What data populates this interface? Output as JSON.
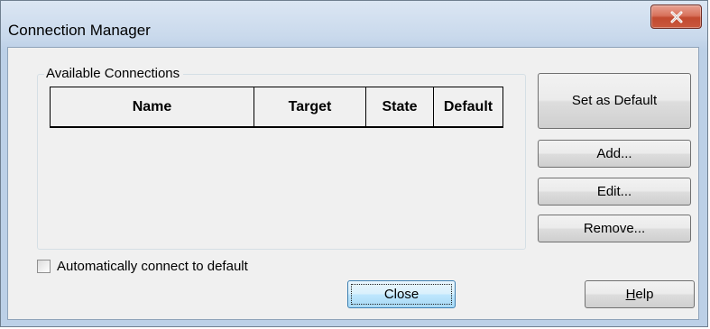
{
  "window": {
    "title": "Connection Manager"
  },
  "connections": {
    "group_label": "Available Connections",
    "columns": [
      "Name",
      "Target",
      "State",
      "Default"
    ],
    "rows": []
  },
  "buttons": {
    "set_default": "Set as Default",
    "add": "Add...",
    "edit": "Edit...",
    "remove": "Remove...",
    "close": "Close",
    "help_mnemonic": "H",
    "help_rest": "elp"
  },
  "auto_connect": {
    "label": "Automatically connect to default",
    "checked": false
  },
  "icons": {
    "title_close": "close-icon"
  },
  "colors": {
    "title_close_bg": "#c9583d",
    "default_button_border": "#3c7fb1"
  }
}
